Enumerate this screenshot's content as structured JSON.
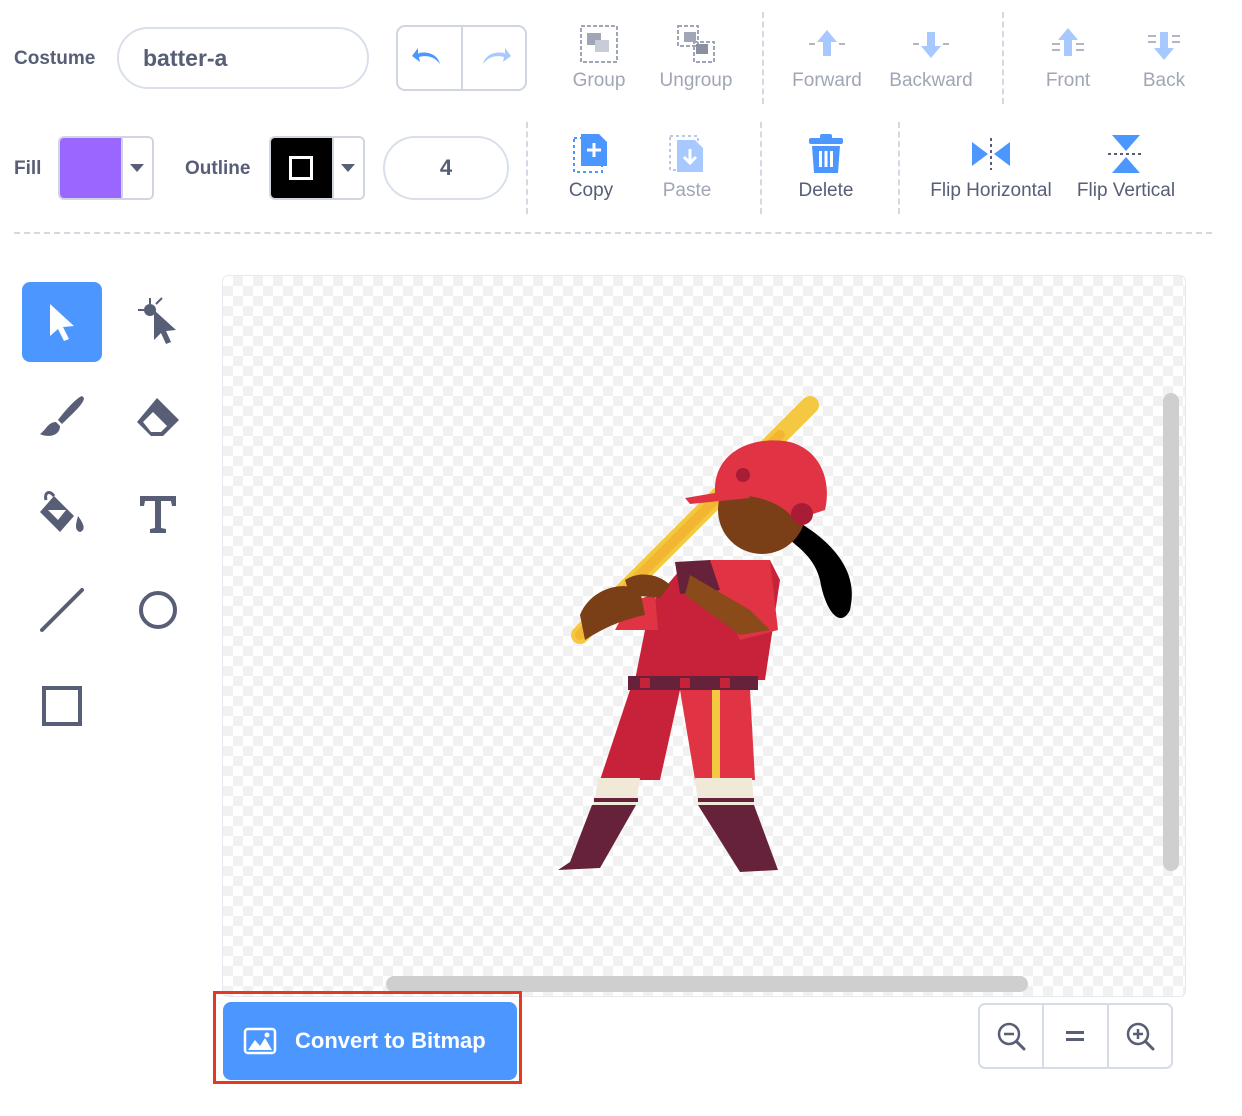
{
  "costume": {
    "label": "Costume",
    "name_value": "batter-a"
  },
  "arrange_tools": {
    "group": "Group",
    "ungroup": "Ungroup",
    "forward": "Forward",
    "backward": "Backward",
    "front": "Front",
    "back": "Back"
  },
  "fill": {
    "label": "Fill",
    "color": "#9966ff"
  },
  "outline": {
    "label": "Outline",
    "color": "#000000",
    "width_value": "4"
  },
  "edit_tools": {
    "copy": "Copy",
    "paste": "Paste",
    "delete": "Delete",
    "flip_horizontal": "Flip Horizontal",
    "flip_vertical": "Flip Vertical"
  },
  "drawing_tools": {
    "active": "select",
    "items": [
      "select",
      "reshape",
      "brush",
      "eraser",
      "fill",
      "text",
      "line",
      "circle",
      "rectangle"
    ]
  },
  "convert": {
    "label": "Convert to Bitmap"
  },
  "zoom": {
    "out_icon": "zoom-out-icon",
    "reset_icon": "zoom-reset-icon",
    "in_icon": "zoom-in-icon"
  },
  "colors": {
    "accent": "#4c97ff",
    "text": "#575e75",
    "disabled": "#a0a6b5",
    "highlight": "#e13a20"
  }
}
